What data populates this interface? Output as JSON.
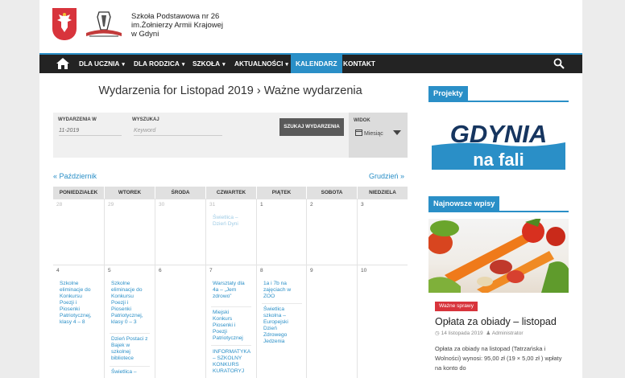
{
  "school": {
    "line1": "Szkoła Podstawowa nr 26",
    "line2": "im.Żołnierzy Armii Krajowej",
    "line3": "w Gdyni"
  },
  "nav": {
    "items": [
      {
        "label": "DLA UCZNIA"
      },
      {
        "label": "DLA RODZICA"
      },
      {
        "label": "SZKOŁA"
      },
      {
        "label": "AKTUALNOŚCI"
      },
      {
        "label": "KALENDARZ"
      },
      {
        "label": "KONTAKT"
      }
    ],
    "chevron": "▾"
  },
  "main": {
    "title": "Wydarzenia for Listopad 2019",
    "title_sep": " › ",
    "title_cat": "Ważne wydarzenia",
    "filter": {
      "date_label": "WYDARZENIA W",
      "date_value": "11-2019",
      "search_label": "WYSZUKAJ",
      "search_placeholder": "Keyword",
      "button": "SZUKAJ WYDARZENIA",
      "view_label": "WIDOK",
      "view_value": "Miesiąc"
    },
    "prev": "« Październik",
    "next": "Grudzień »"
  },
  "calendar": {
    "days": [
      "PONIEDZIAŁEK",
      "WTOREK",
      "ŚRODA",
      "CZWARTEK",
      "PIĄTEK",
      "SOBOTA",
      "NIEDZIELA"
    ],
    "week1": [
      "28",
      "29",
      "30",
      "31",
      "1",
      "2",
      "3"
    ],
    "week2": [
      "4",
      "5",
      "6",
      "7",
      "8",
      "9",
      "10"
    ],
    "events": {
      "thu31": "Świetlica – Dzień Dyni",
      "mon4": "Szkolne eliminacje do Konkursu Poezji i Piosenki Patriotycznej, klasy 4 – 8",
      "tue5a": "Szkolne eliminacje do Konkursu Poezji i Piosenki Patriotycznej, klasy 0 – 3",
      "tue5b": "Dzień Postaci z Bajek w szkolnej bibliotece",
      "tue5c": "Świetlica –",
      "thu7a": "Warsztaty dla 4a – „Jem zdrowo”",
      "thu7b": "Miejski Konkurs Piosenki i Poezji Patriotycznej",
      "thu7c": "INFORMATYKA – SZKOLNY KONKURS KURATORYJ",
      "fri8a": "1a i 7b na zajęciach w ZOO",
      "fri8b": "Świetlica szkolna – Europejski Dzień Zdrowego Jedzenia"
    }
  },
  "sidebar": {
    "projekty": "Projekty",
    "gdynia_top": "GDYNIA",
    "gdynia_bottom": "na fali",
    "recent": "Najnowsze wpisy",
    "post": {
      "tag": "Ważne sprawy",
      "title": "Opłata za obiady – listopad",
      "date": "14 listopada 2019",
      "author": "Administrator",
      "excerpt": "Opłata za obiady na listopad (Tatrzańska i Wolności) wynosi: 95,00 zł  (19 × 5,00 zł ) wpłaty na konto  do"
    }
  },
  "colors": {
    "accent": "#2a8fc7",
    "nav_bg": "#232323",
    "tag": "#d8343c"
  }
}
